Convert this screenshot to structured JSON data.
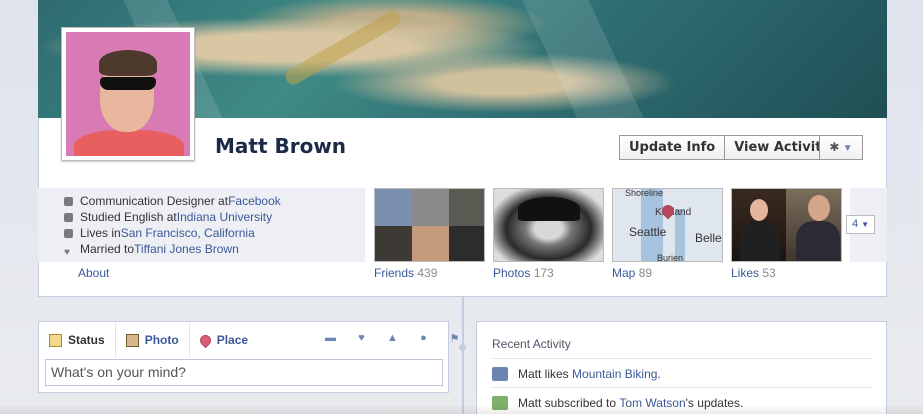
{
  "profile": {
    "name": "Matt Brown",
    "update_info_label": "Update Info",
    "view_activity_label": "View Activity",
    "gear_icon": "gear-icon"
  },
  "info": {
    "items": [
      {
        "icon": "briefcase-icon",
        "prefix": "Communication Designer at ",
        "link": "Facebook"
      },
      {
        "icon": "school-icon",
        "prefix": "Studied English at ",
        "link": "Indiana University"
      },
      {
        "icon": "home-icon",
        "prefix": "Lives in ",
        "link": "San Francisco, California"
      },
      {
        "icon": "heart-icon",
        "prefix": "Married to ",
        "link": "Tiffani Jones Brown"
      }
    ],
    "about_label": "About"
  },
  "tiles": {
    "friends": {
      "label": "Friends",
      "count": "439"
    },
    "photos": {
      "label": "Photos",
      "count": "173"
    },
    "map": {
      "label": "Map",
      "count": "89",
      "places": [
        "Shoreline",
        "Kirkland",
        "Seattle",
        "Belle",
        "Burien"
      ]
    },
    "likes": {
      "label": "Likes",
      "count": "53"
    },
    "more_label": "4"
  },
  "composer": {
    "tabs": [
      {
        "label": "Status",
        "icon": "status-icon"
      },
      {
        "label": "Photo",
        "icon": "photo-icon"
      },
      {
        "label": "Place",
        "icon": "place-icon"
      }
    ],
    "placeholder": "What's on your mind?"
  },
  "recent": {
    "title": "Recent Activity",
    "items": [
      {
        "actor": "Matt",
        "middle": " likes ",
        "link": "Mountain Biking",
        "suffix": "."
      },
      {
        "actor": "Matt",
        "middle": " subscribed to ",
        "link": "Tom Watson",
        "suffix": "'s updates."
      }
    ]
  }
}
